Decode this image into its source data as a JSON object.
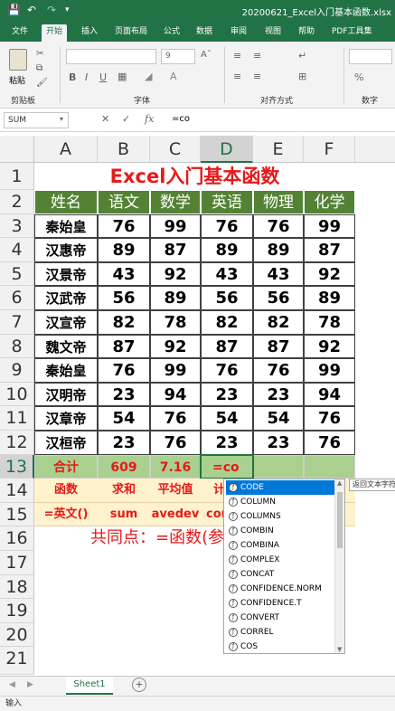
{
  "window": {
    "title": "20200621_Excel入门基本函数.xlsx"
  },
  "quick_access": {
    "save": "save-icon",
    "undo": "undo-icon",
    "redo": "redo-icon",
    "customize": "customize-icon"
  },
  "ribbon": {
    "tabs": [
      "文件",
      "开始",
      "插入",
      "页面布局",
      "公式",
      "数据",
      "审阅",
      "视图",
      "帮助",
      "PDF工具集"
    ],
    "active_tab": "开始",
    "paste_label": "粘贴",
    "groups": [
      "剪贴板",
      "字体",
      "对齐方式",
      "数字"
    ],
    "font_size": "9"
  },
  "formula_bar": {
    "name_box": "SUM",
    "content": "=co",
    "fx": "fx"
  },
  "columns": [
    "A",
    "B",
    "C",
    "D",
    "E",
    "F"
  ],
  "rows": [
    "1",
    "2",
    "3",
    "4",
    "5",
    "6",
    "7",
    "8",
    "9",
    "10",
    "11",
    "12",
    "13",
    "14",
    "15",
    "16",
    "17",
    "18",
    "19",
    "20",
    "21"
  ],
  "sheet": {
    "title": "Excel入门基本函数",
    "headers": [
      "姓名",
      "语文",
      "数学",
      "英语",
      "物理",
      "化学"
    ],
    "data": [
      [
        "秦始皇",
        "76",
        "99",
        "76",
        "76",
        "99"
      ],
      [
        "汉惠帝",
        "89",
        "87",
        "89",
        "89",
        "87"
      ],
      [
        "汉景帝",
        "43",
        "92",
        "43",
        "43",
        "92"
      ],
      [
        "汉武帝",
        "56",
        "89",
        "56",
        "56",
        "89"
      ],
      [
        "汉宣帝",
        "82",
        "78",
        "82",
        "82",
        "78"
      ],
      [
        "魏文帝",
        "87",
        "92",
        "87",
        "87",
        "92"
      ],
      [
        "秦始皇",
        "76",
        "99",
        "76",
        "76",
        "99"
      ],
      [
        "汉明帝",
        "23",
        "94",
        "23",
        "23",
        "94"
      ],
      [
        "汉章帝",
        "54",
        "76",
        "54",
        "54",
        "76"
      ],
      [
        "汉桓帝",
        "23",
        "76",
        "23",
        "23",
        "76"
      ]
    ],
    "total_row": [
      "合计",
      "609",
      "7.16",
      "=co"
    ],
    "func_row": [
      "函数",
      "求和",
      "平均值",
      "计"
    ],
    "syntax_row": [
      "=英文()",
      "sum",
      "avedev",
      "cou"
    ],
    "note": "共同点：=函数(参"
  },
  "autocomplete": {
    "items": [
      "CODE",
      "COLUMN",
      "COLUMNS",
      "COMBIN",
      "COMBINA",
      "COMPLEX",
      "CONCAT",
      "CONFIDENCE.NORM",
      "CONFIDENCE.T",
      "CONVERT",
      "CORREL",
      "COS"
    ],
    "selected": "CODE",
    "tooltip": "返回文本字符"
  },
  "sheet_tabs": {
    "name": "Sheet1",
    "add": "+"
  },
  "status_bar": {
    "mode": "输入"
  }
}
